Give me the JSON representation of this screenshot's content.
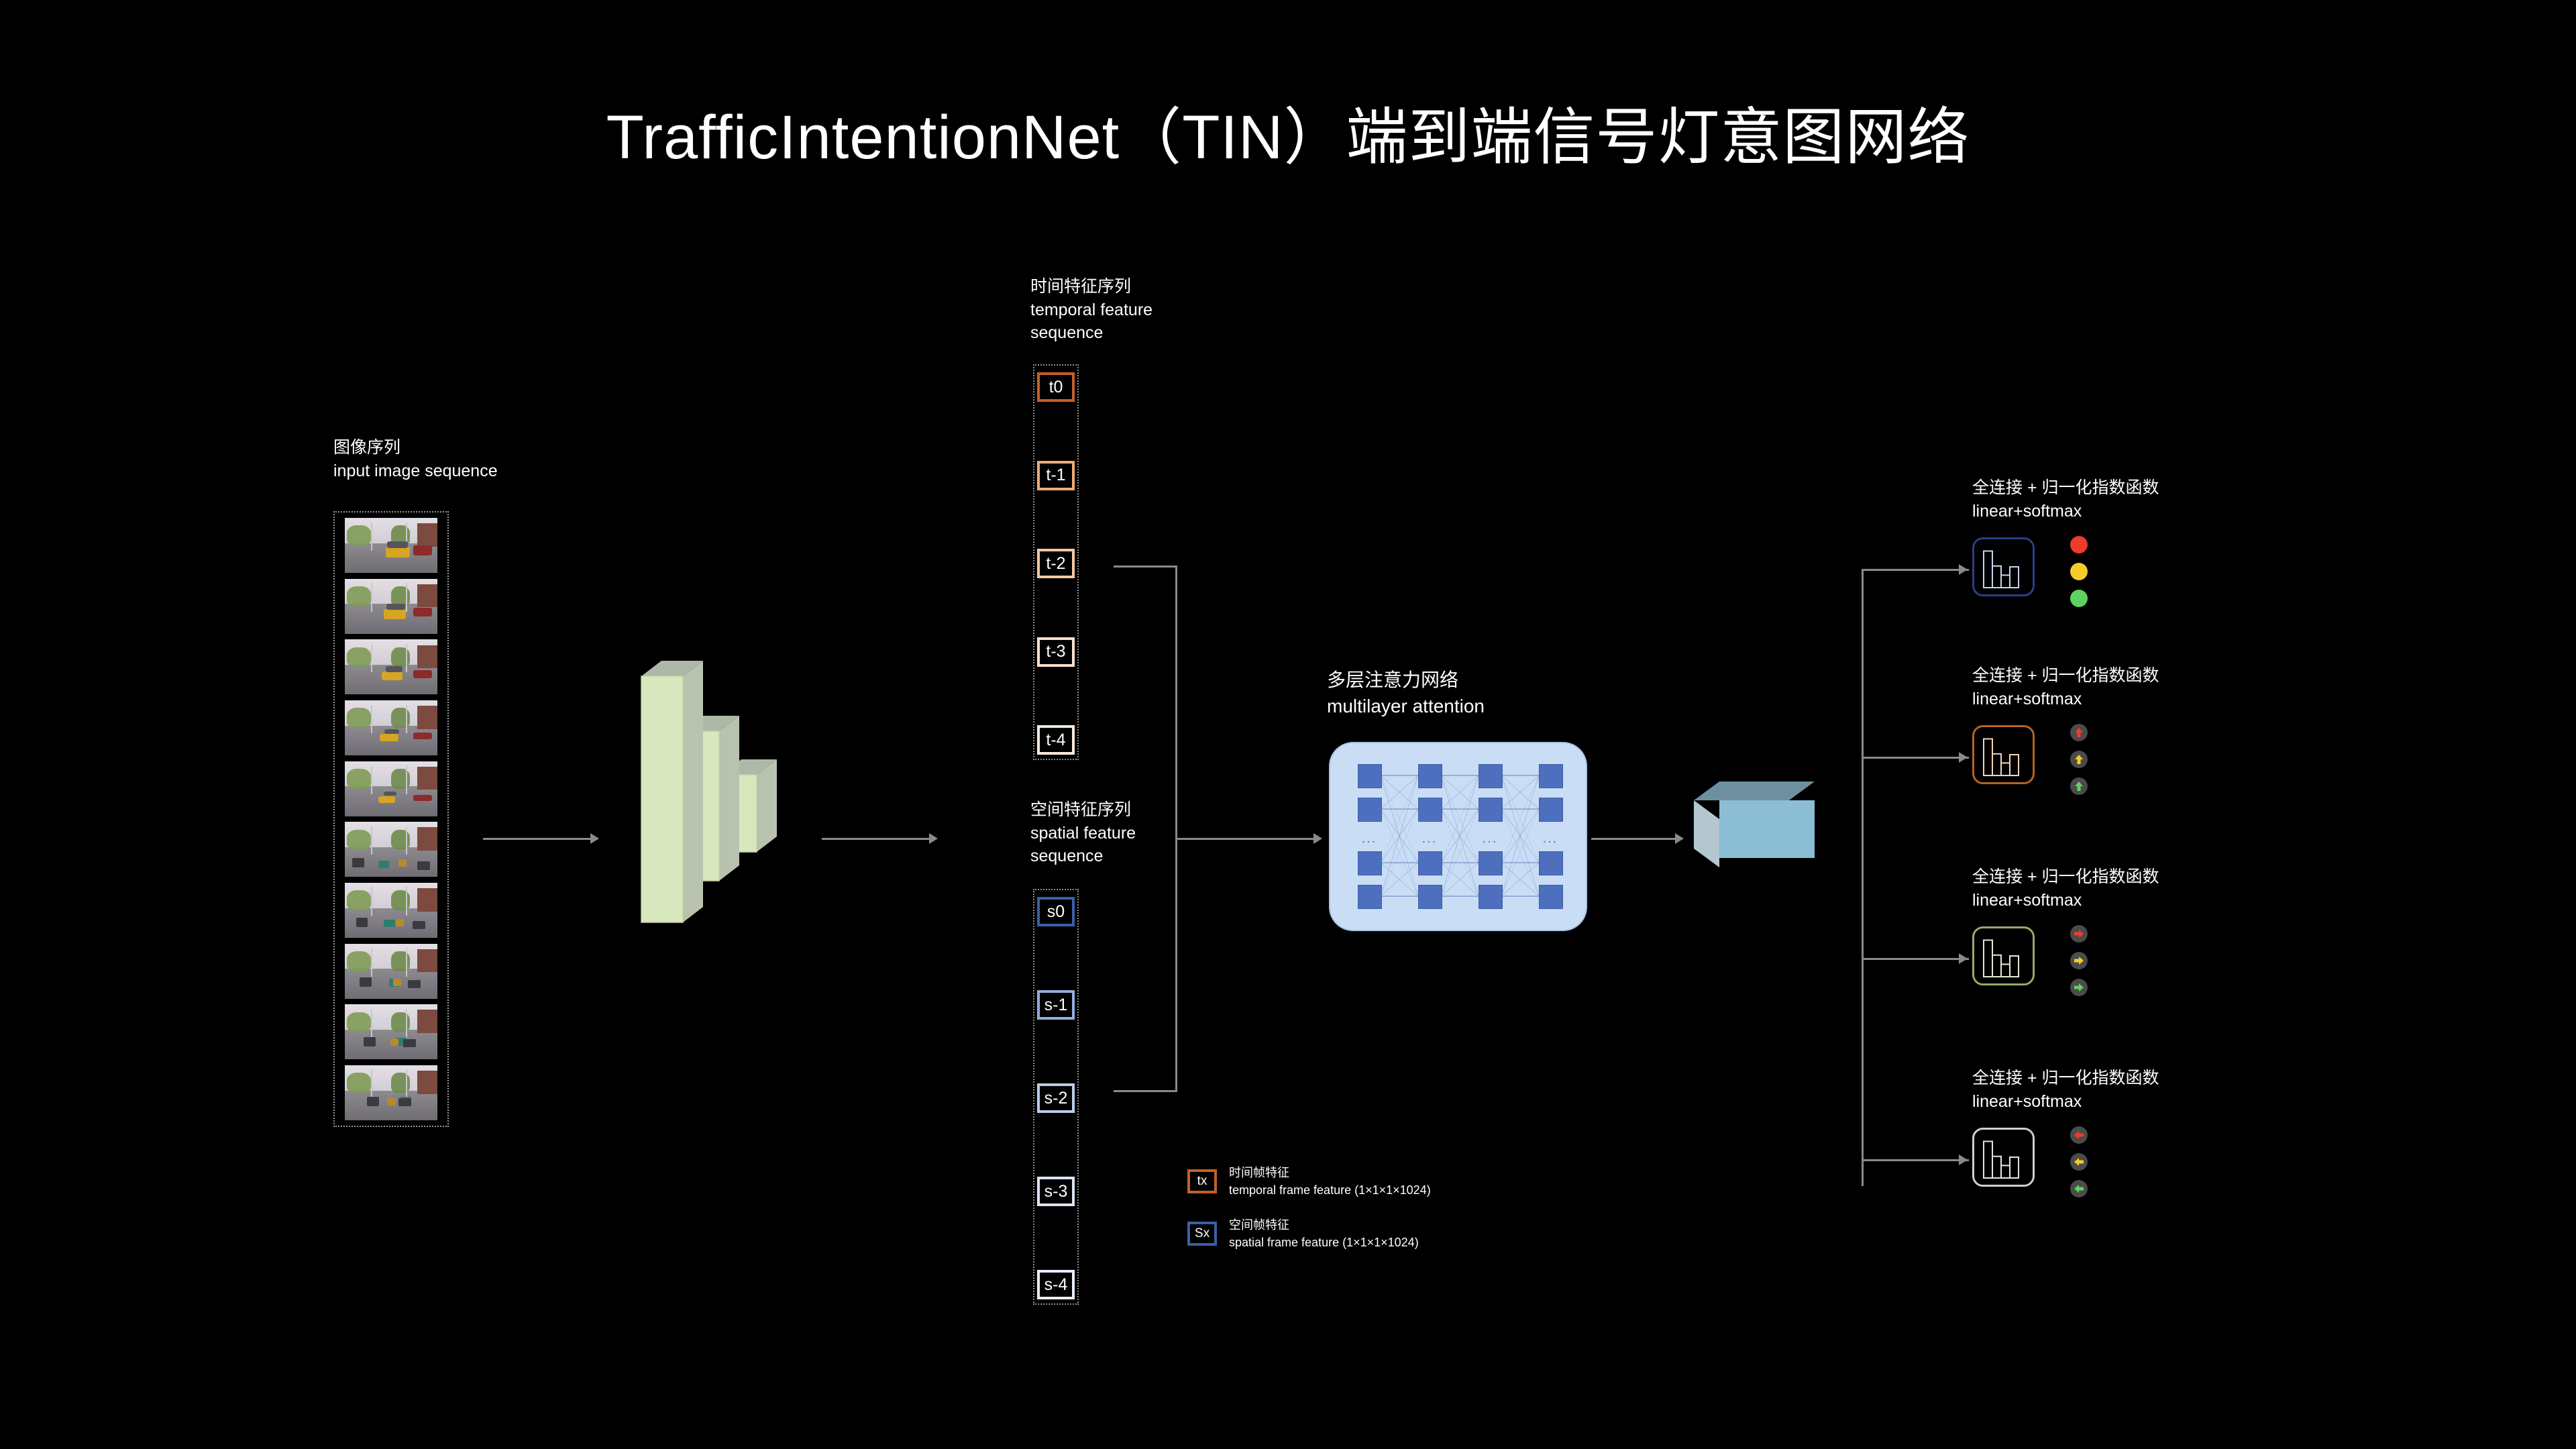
{
  "title": "TrafficIntentionNet（TIN）端到端信号灯意图网络",
  "input": {
    "label_cn": "图像序列",
    "label_en": "input image sequence",
    "frame_count": 10
  },
  "backbone": {
    "name": "cnn-feature-extractor",
    "slab_count": 3,
    "face_color": "#d8e7bd",
    "top_color": "#aeb8a6",
    "side_color": "#b8c2ae"
  },
  "temporal": {
    "label_cn": "时间特征序列",
    "label_en_line1": "temporal feature",
    "label_en_line2": "sequence",
    "items": [
      {
        "label": "t0",
        "border": "#c2602a"
      },
      {
        "label": "t-1",
        "border": "#edab77"
      },
      {
        "label": "t-2",
        "border": "#f4c8a6"
      },
      {
        "label": "t-3",
        "border": "#fae0d0"
      },
      {
        "label": "t-4",
        "border": "#fbe8dc"
      }
    ]
  },
  "spatial": {
    "label_cn": "空间特征序列",
    "label_en_line1": "spatial feature",
    "label_en_line2": "sequence",
    "items": [
      {
        "label": "s0",
        "border": "#3a5fa8"
      },
      {
        "label": "s-1",
        "border": "#93aedd"
      },
      {
        "label": "s-2",
        "border": "#b9cbe9"
      },
      {
        "label": "s-3",
        "border": "#dbe4f4"
      },
      {
        "label": "s-4",
        "border": "#e8eefb"
      }
    ]
  },
  "attention": {
    "label_cn": "多层注意力网络",
    "label_en": "multilayer attention",
    "columns": 4,
    "node_rows": 4,
    "ellipsis": "...",
    "panel_color": "#c9ddf5",
    "node_color": "#4e6fbe"
  },
  "fusion": {
    "name": "fused-feature-cube",
    "front_color": "#8bbdd4",
    "top_color": "#6e8fa0",
    "side_color": "#b4c6d0"
  },
  "heads": [
    {
      "label_cn": "全连接 + 归一化指数函数",
      "label_en": "linear+softmax",
      "box_border": "#2c3f87",
      "bar_color": "#c9d4ee",
      "bars": [
        88,
        52,
        30,
        50
      ],
      "icon_type": "traffic-light-circle",
      "icons": [
        {
          "name": "red-light",
          "color": "#ef3b2c"
        },
        {
          "name": "yellow-light",
          "color": "#f5cc2a"
        },
        {
          "name": "green-light",
          "color": "#5fd35f"
        }
      ]
    },
    {
      "label_cn": "全连接 + 归一化指数函数",
      "label_en": "linear+softmax",
      "box_border": "#b5631f",
      "bar_color": "#f3d5bb",
      "bars": [
        88,
        52,
        30,
        50
      ],
      "icon_type": "arrow-up",
      "icons": [
        {
          "name": "red-arrow-up",
          "color": "#ef3b2c"
        },
        {
          "name": "yellow-arrow-up",
          "color": "#f5cc2a"
        },
        {
          "name": "green-arrow-up",
          "color": "#5fd35f"
        }
      ]
    },
    {
      "label_cn": "全连接 + 归一化指数函数",
      "label_en": "linear+softmax",
      "box_border": "#95ab6a",
      "bar_color": "#e4ead0",
      "bars": [
        88,
        52,
        30,
        50
      ],
      "icon_type": "arrow-right",
      "icons": [
        {
          "name": "red-arrow-right",
          "color": "#ef3b2c"
        },
        {
          "name": "yellow-arrow-right",
          "color": "#f5cc2a"
        },
        {
          "name": "green-arrow-right",
          "color": "#5fd35f"
        }
      ]
    },
    {
      "label_cn": "全连接 + 归一化指数函数",
      "label_en": "linear+softmax",
      "box_border": "#cfcfcf",
      "bar_color": "#e6e6e6",
      "bars": [
        88,
        52,
        30,
        50
      ],
      "icon_type": "arrow-left",
      "icons": [
        {
          "name": "red-arrow-left",
          "color": "#ef3b2c"
        },
        {
          "name": "yellow-arrow-left",
          "color": "#f5cc2a"
        },
        {
          "name": "green-arrow-left",
          "color": "#5fd35f"
        }
      ]
    }
  ],
  "legend": [
    {
      "key": "tx",
      "border": "#c2602a",
      "label_cn": "时间帧特征",
      "label_en": "temporal frame feature (1×1×1×1024)"
    },
    {
      "key": "Sx",
      "border": "#3a5fa8",
      "label_cn": "空间帧特征",
      "label_en": "spatial frame feature (1×1×1×1024)"
    }
  ]
}
